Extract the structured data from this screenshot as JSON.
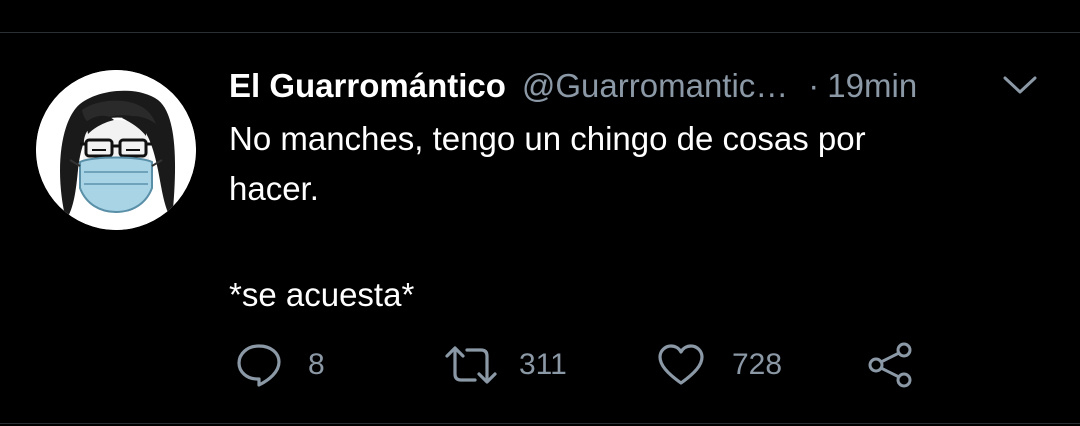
{
  "tweet": {
    "display_name": "El Guarromántico",
    "handle": "@Guarromantic…",
    "separator": "·",
    "time": "19min",
    "text_lines": [
      "No manches, tengo un chingo de cosas por",
      "hacer."
    ],
    "text_after_break": "*se acuesta*"
  },
  "actions": {
    "reply_count": "8",
    "retweet_count": "311",
    "like_count": "728"
  },
  "icons": {
    "reply": "speech-bubble-icon",
    "retweet": "retweet-arrows-icon",
    "like": "heart-icon",
    "share": "share-nodes-icon",
    "menu": "chevron-down-icon"
  },
  "colors": {
    "background": "#000000",
    "primary_text": "#ffffff",
    "secondary_text": "#8b98a5"
  }
}
